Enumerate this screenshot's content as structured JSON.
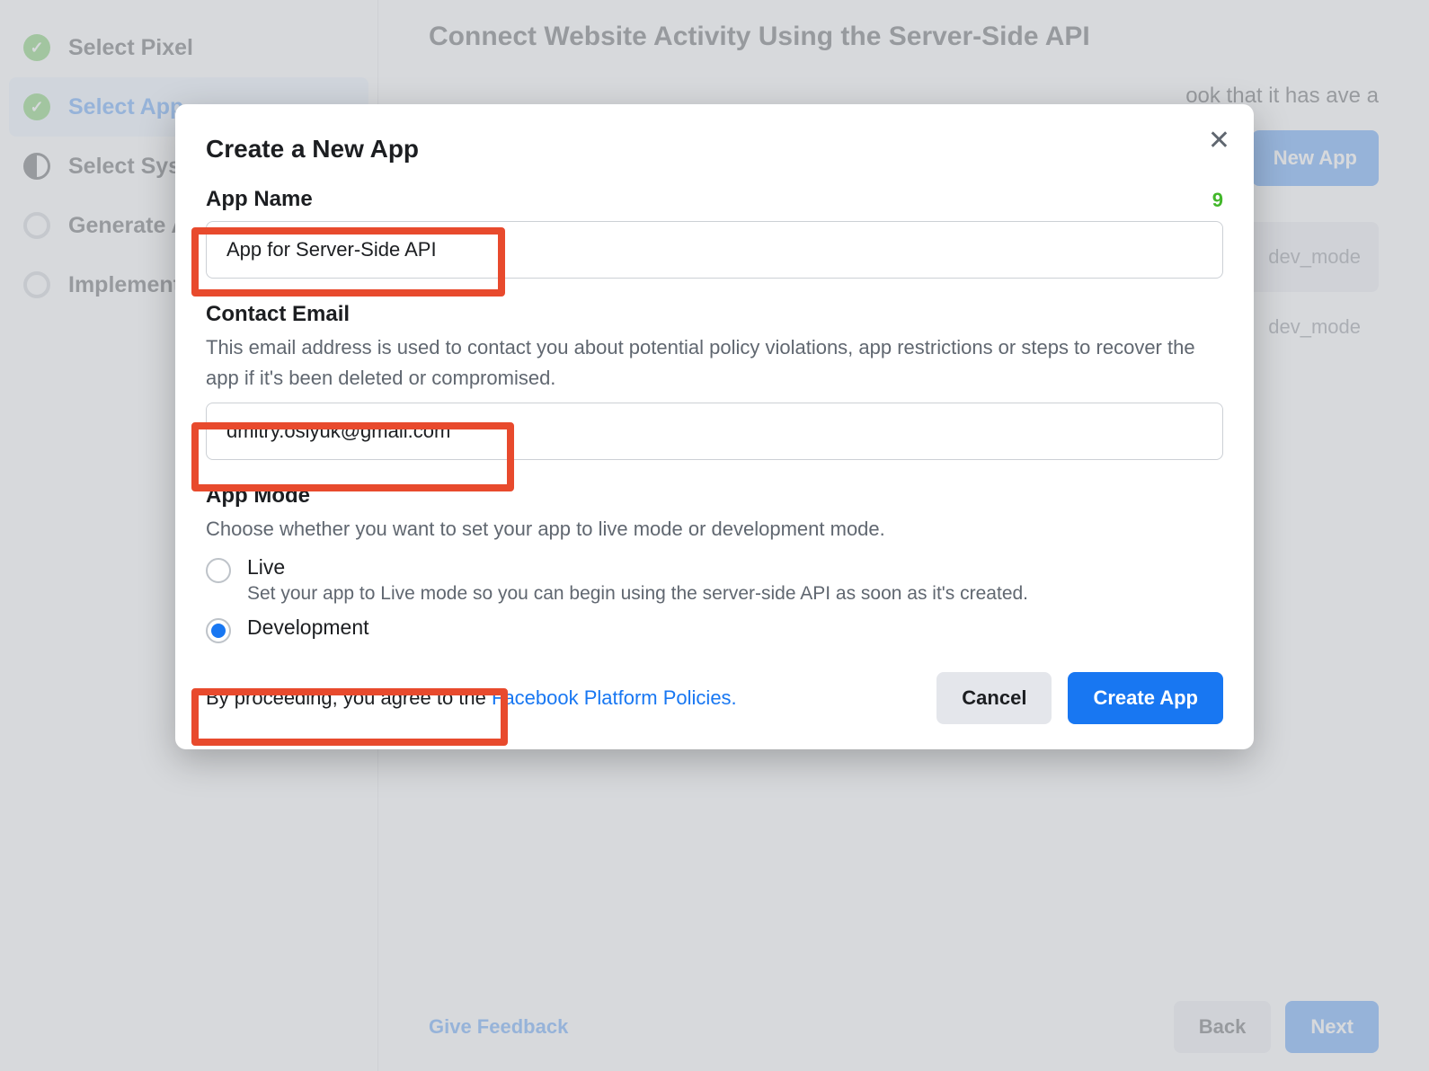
{
  "sidebar": {
    "items": [
      {
        "label": "Select Pixel",
        "state": "done"
      },
      {
        "label": "Select App",
        "state": "done",
        "active": true
      },
      {
        "label": "Select System User",
        "state": "half"
      },
      {
        "label": "Generate Access Token",
        "state": "empty"
      },
      {
        "label": "Implement API",
        "state": "empty"
      }
    ]
  },
  "page": {
    "title": "Connect Website Activity Using the Server-Side API",
    "snippet_right": "ook that it has ave a",
    "new_app_button": "New App",
    "chip_text_1": "dev_mode",
    "chip_text_2": "dev_mode",
    "feedback_link": "Give Feedback",
    "back_button": "Back",
    "next_button": "Next"
  },
  "modal": {
    "title": "Create a New App",
    "app_name_label": "App Name",
    "app_name_count": "9",
    "app_name_value": "App for Server-Side API",
    "contact_label": "Contact Email",
    "contact_help": "This email address is used to contact you about potential policy violations, app restrictions or steps to recover the app if it's been deleted or compromised.",
    "contact_value": "dmitry.osiyuk@gmail.com",
    "mode_label": "App Mode",
    "mode_help": "Choose whether you want to set your app to live mode or development mode.",
    "live_label": "Live",
    "live_sub": "Set your app to Live mode so you can begin using the server-side API as soon as it's created.",
    "dev_label": "Development",
    "policy_prefix": "By proceeding, you agree to the ",
    "policy_link": "Facebook Platform Policies.",
    "cancel": "Cancel",
    "create": "Create App"
  }
}
